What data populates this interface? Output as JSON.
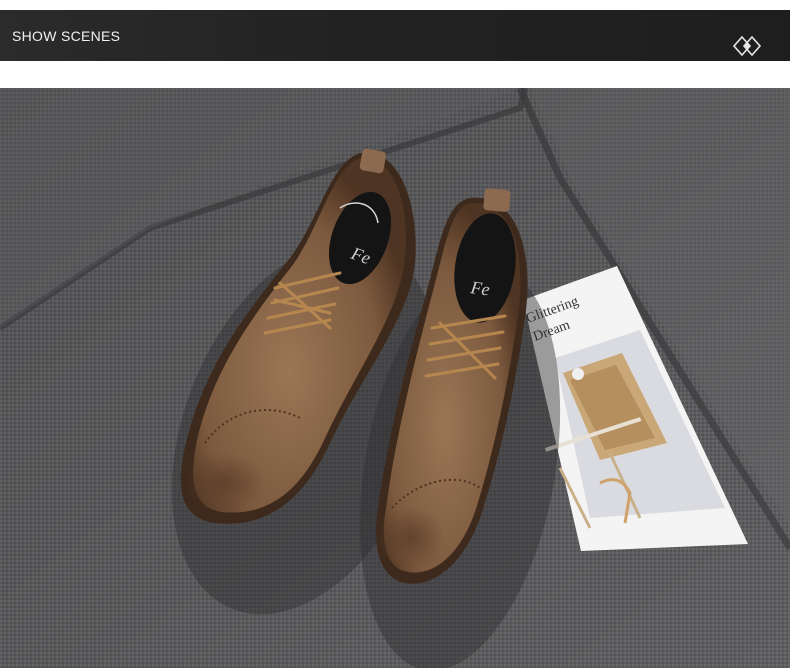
{
  "header": {
    "title": "SHOW SCENES",
    "icon": "double-diamond-icon"
  },
  "photo": {
    "subject": "brown-brogue-shoes",
    "magazine_text_line1": "Glittering",
    "magazine_text_line2": "Dream",
    "shoe_insole_logo": "Fe"
  },
  "colors": {
    "banner_background": "#222222",
    "banner_text": "#f2f2f2",
    "sofa_fabric": "#5d5d5f",
    "leather": "#8a6547"
  }
}
